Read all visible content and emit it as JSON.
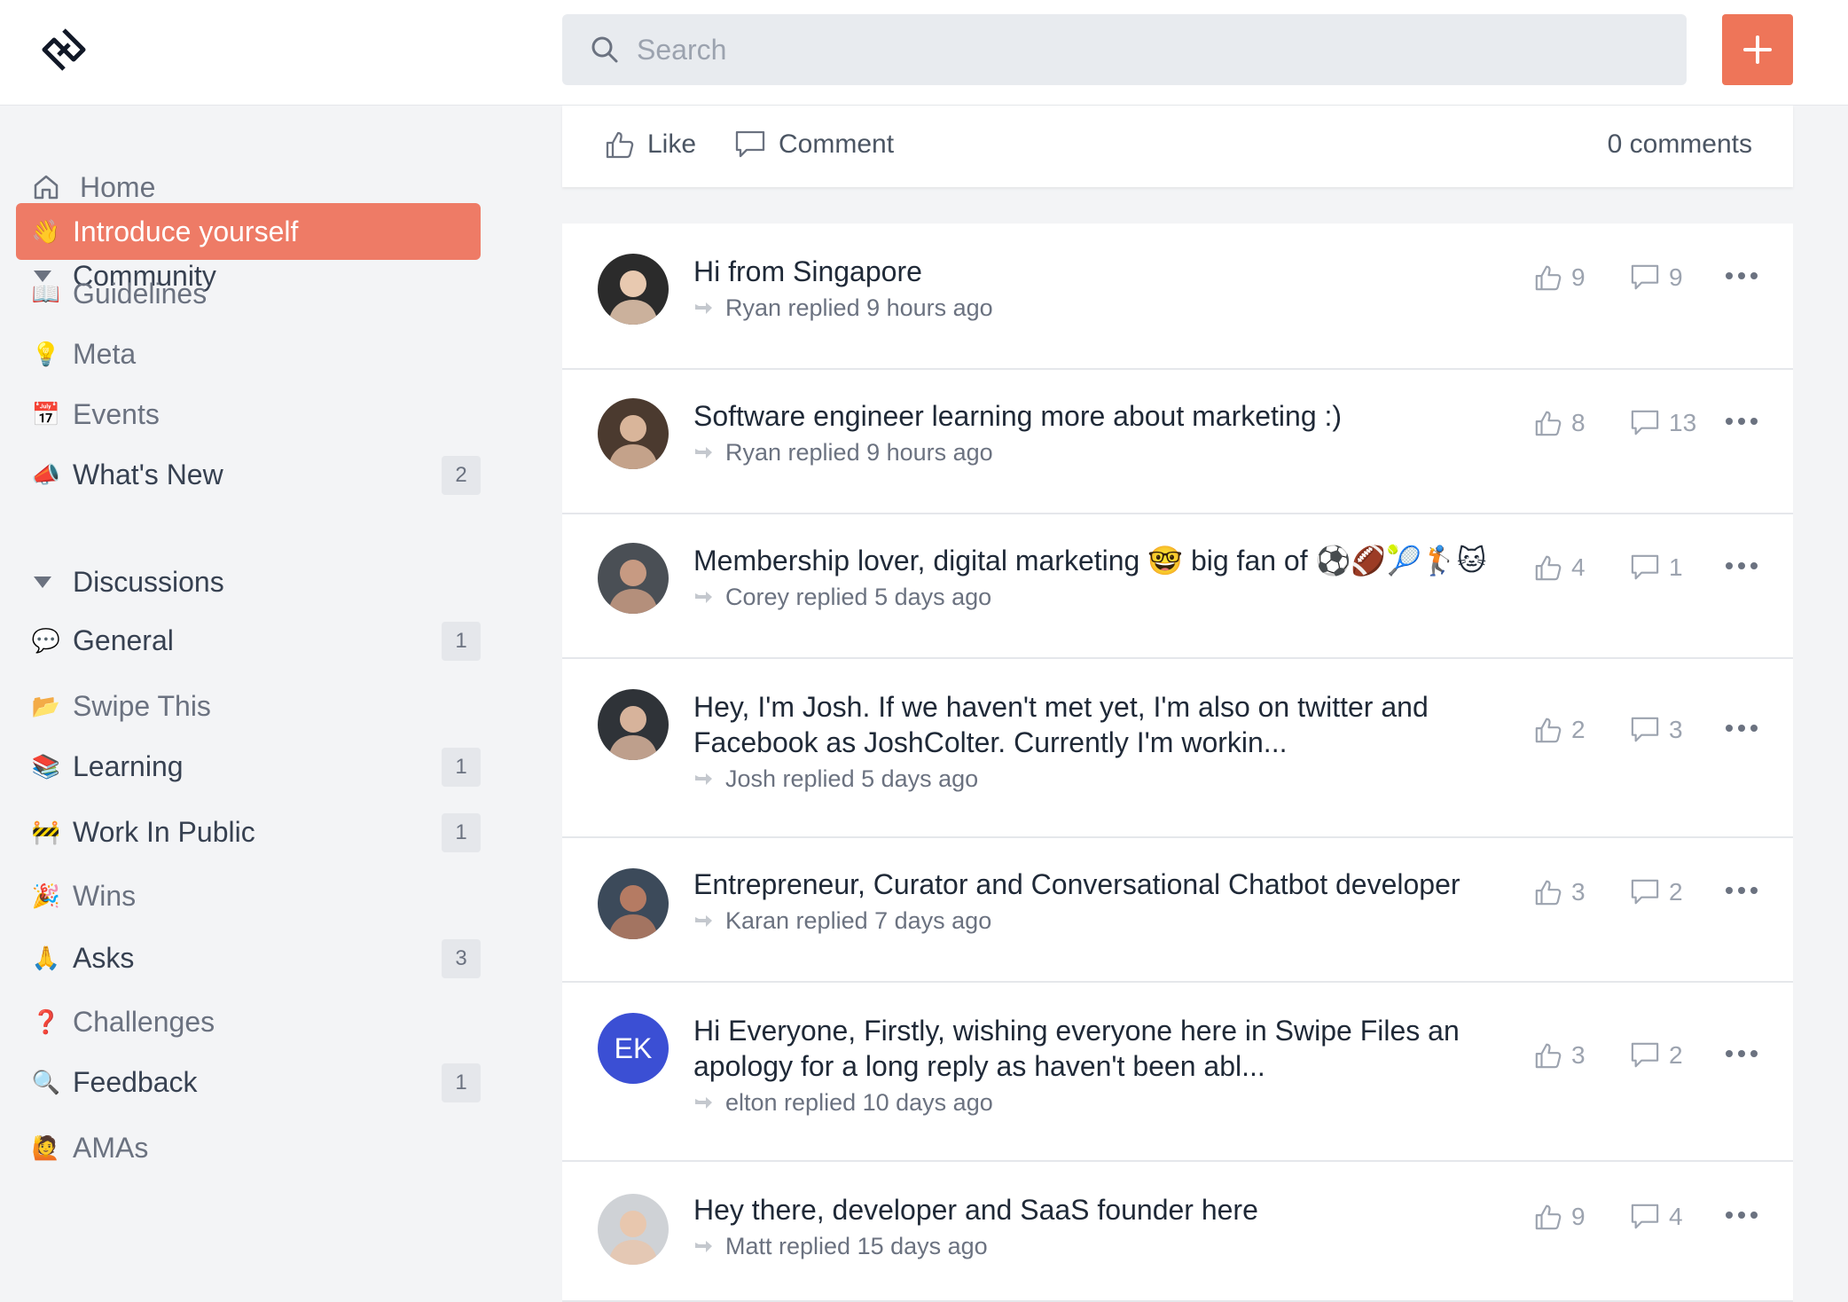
{
  "search": {
    "placeholder": "Search"
  },
  "sidebar": {
    "home": "Home",
    "community": {
      "heading": "Community",
      "items": [
        {
          "emoji": "👋",
          "label": "Introduce yourself",
          "badge": ""
        },
        {
          "emoji": "📖",
          "label": "Guidelines",
          "badge": ""
        },
        {
          "emoji": "💡",
          "label": "Meta",
          "badge": ""
        },
        {
          "emoji": "📅",
          "label": "Events",
          "badge": ""
        },
        {
          "emoji": "📣",
          "label": "What's New",
          "badge": "2"
        }
      ]
    },
    "discussions": {
      "heading": "Discussions",
      "items": [
        {
          "emoji": "💬",
          "label": "General",
          "badge": "1"
        },
        {
          "emoji": "📂",
          "label": "Swipe This",
          "badge": ""
        },
        {
          "emoji": "📚",
          "label": "Learning",
          "badge": "1"
        },
        {
          "emoji": "🚧",
          "label": "Work In Public",
          "badge": "1"
        },
        {
          "emoji": "🎉",
          "label": "Wins",
          "badge": ""
        },
        {
          "emoji": "🙏",
          "label": "Asks",
          "badge": "3"
        },
        {
          "emoji": "❓",
          "label": "Challenges",
          "badge": ""
        },
        {
          "emoji": "🔍",
          "label": "Feedback",
          "badge": "1"
        },
        {
          "emoji": "🙋",
          "label": "AMAs",
          "badge": ""
        }
      ]
    }
  },
  "post_actions": {
    "like": "Like",
    "comment": "Comment",
    "comments_count": "0 comments"
  },
  "feed": [
    {
      "title": "Hi from Singapore",
      "meta": "Ryan replied 9 hours ago",
      "likes": "9",
      "comments": "9"
    },
    {
      "title": "Software engineer learning more about marketing :)",
      "meta": "Ryan replied 9 hours ago",
      "likes": "8",
      "comments": "13"
    },
    {
      "title": "Membership lover, digital marketing 🤓 big fan of ⚽🏈🎾🏌🐱",
      "meta": "Corey replied 5 days ago",
      "likes": "4",
      "comments": "1"
    },
    {
      "title": "Hey, I'm Josh. If we haven't met yet, I'm also on twitter and Facebook as JoshColter. Currently I'm workin...",
      "meta": "Josh replied 5 days ago",
      "likes": "2",
      "comments": "3"
    },
    {
      "title": "Entrepreneur, Curator and Conversational Chatbot developer",
      "meta": "Karan replied 7 days ago",
      "likes": "3",
      "comments": "2"
    },
    {
      "title": "Hi Everyone, Firstly, wishing everyone here in Swipe Files an apology for a long reply as haven't been abl...",
      "meta": "elton replied 10 days ago",
      "likes": "3",
      "comments": "2",
      "initials": "EK"
    },
    {
      "title": "Hey there, developer and SaaS founder here",
      "meta": "Matt replied 15 days ago",
      "likes": "9",
      "comments": "4"
    }
  ],
  "colors": {
    "accent": "#ee7559",
    "active_item": "#ee7b66",
    "ek_avatar": "#3b4fd4"
  }
}
